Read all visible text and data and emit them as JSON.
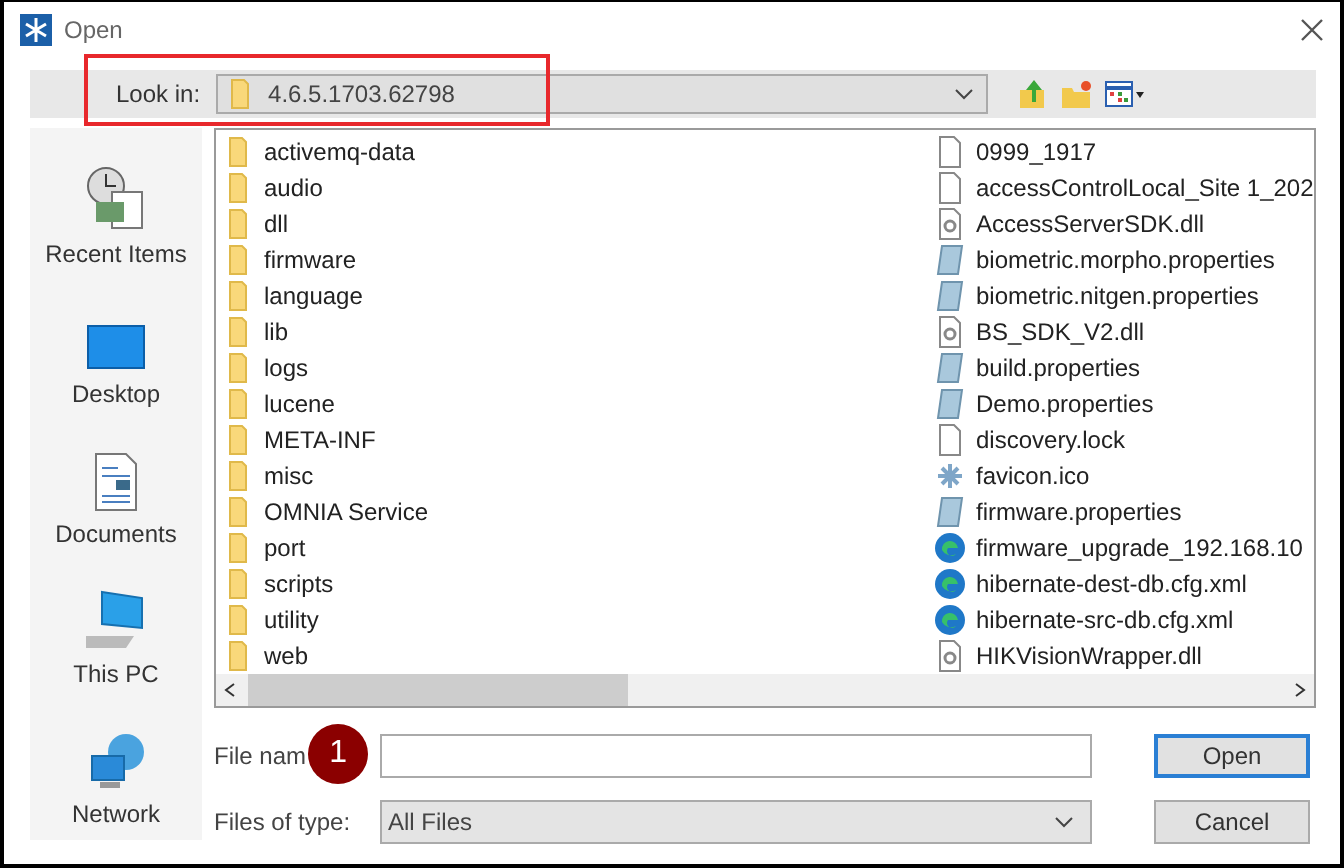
{
  "window": {
    "title": "Open"
  },
  "look_in": {
    "label": "Look in:",
    "value": "4.6.5.1703.62798"
  },
  "sidebar": {
    "items": [
      {
        "label": "Recent Items",
        "kind": "recent"
      },
      {
        "label": "Desktop",
        "kind": "desktop"
      },
      {
        "label": "Documents",
        "kind": "documents"
      },
      {
        "label": "This PC",
        "kind": "pc"
      },
      {
        "label": "Network",
        "kind": "network"
      }
    ]
  },
  "files": {
    "columns": [
      [
        {
          "name": "activemq-data",
          "kind": "folder"
        },
        {
          "name": "audio",
          "kind": "folder"
        },
        {
          "name": "dll",
          "kind": "folder"
        },
        {
          "name": "firmware",
          "kind": "folder"
        },
        {
          "name": "language",
          "kind": "folder"
        },
        {
          "name": "lib",
          "kind": "folder"
        },
        {
          "name": "logs",
          "kind": "folder"
        },
        {
          "name": "lucene",
          "kind": "folder"
        },
        {
          "name": "META-INF",
          "kind": "folder"
        },
        {
          "name": "misc",
          "kind": "folder"
        },
        {
          "name": "OMNIA Service",
          "kind": "folder"
        },
        {
          "name": "port",
          "kind": "folder"
        },
        {
          "name": "scripts",
          "kind": "folder"
        },
        {
          "name": "utility",
          "kind": "folder"
        },
        {
          "name": "web",
          "kind": "folder"
        }
      ],
      [
        {
          "name": "0999_1917",
          "kind": "file"
        },
        {
          "name": "accessControlLocal_Site 1_202",
          "kind": "file"
        },
        {
          "name": "AccessServerSDK.dll",
          "kind": "dll"
        },
        {
          "name": "biometric.morpho.properties",
          "kind": "properties"
        },
        {
          "name": "biometric.nitgen.properties",
          "kind": "properties"
        },
        {
          "name": "BS_SDK_V2.dll",
          "kind": "dll"
        },
        {
          "name": "build.properties",
          "kind": "properties"
        },
        {
          "name": "Demo.properties",
          "kind": "properties"
        },
        {
          "name": "discovery.lock",
          "kind": "file"
        },
        {
          "name": "favicon.ico",
          "kind": "ico"
        },
        {
          "name": "firmware.properties",
          "kind": "properties"
        },
        {
          "name": "firmware_upgrade_192.168.10",
          "kind": "edge"
        },
        {
          "name": "hibernate-dest-db.cfg.xml",
          "kind": "edge"
        },
        {
          "name": "hibernate-src-db.cfg.xml",
          "kind": "edge"
        },
        {
          "name": "HIKVisionWrapper.dll",
          "kind": "dll"
        }
      ]
    ]
  },
  "file_name": {
    "label": "File nam"
  },
  "file_type": {
    "label": "Files of type:",
    "value": "All Files"
  },
  "buttons": [
    "Open",
    "Cancel"
  ],
  "annotation": {
    "badge": "1"
  }
}
